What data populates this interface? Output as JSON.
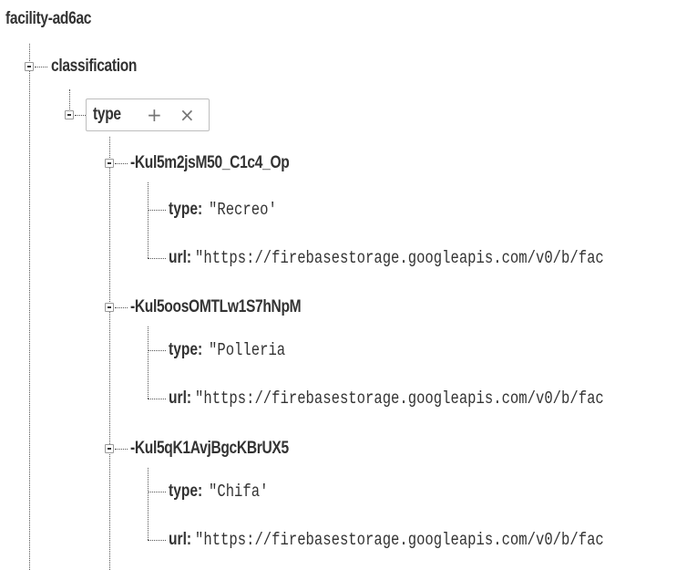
{
  "tree": {
    "root_key": "facility-ad6ac",
    "classification": {
      "key": "classification",
      "type_node": {
        "key": "type",
        "add_icon": "+",
        "remove_icon": "×",
        "children": [
          {
            "key": "-Kul5m2jsM50_C1c4_Op",
            "fields": [
              {
                "key": "type:",
                "value": "\"Recreo'"
              },
              {
                "key": "url:",
                "value": "\"https://firebasestorage.googleapis.com/v0/b/fac"
              }
            ]
          },
          {
            "key": "-Kul5oosOMTLw1S7hNpM",
            "fields": [
              {
                "key": "type:",
                "value": "\"Polleria"
              },
              {
                "key": "url:",
                "value": "\"https://firebasestorage.googleapis.com/v0/b/fac"
              }
            ]
          },
          {
            "key": "-Kul5qK1AvjBgcKBrUX5",
            "fields": [
              {
                "key": "type:",
                "value": "\"Chifa'"
              },
              {
                "key": "url:",
                "value": "\"https://firebasestorage.googleapis.com/v0/b/fac"
              }
            ]
          }
        ]
      }
    }
  },
  "icons": {
    "collapse": "minus-square-icon",
    "add": "plus-icon",
    "remove": "close-icon"
  }
}
